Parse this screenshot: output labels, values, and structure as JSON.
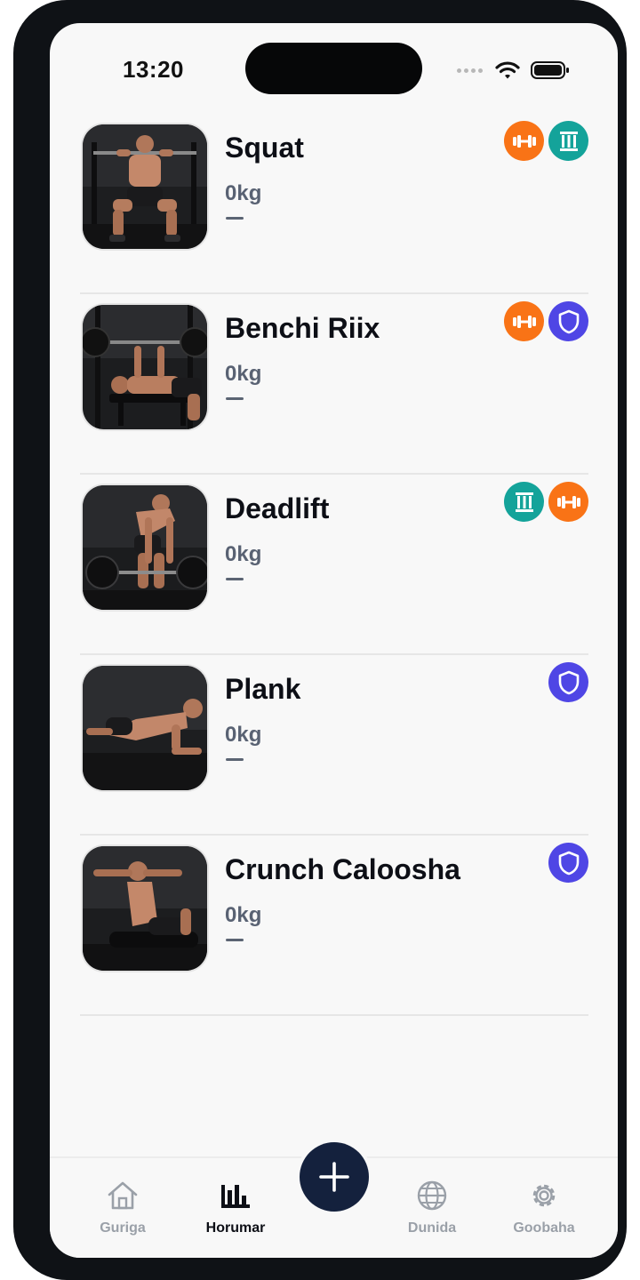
{
  "status_bar": {
    "time": "13:20"
  },
  "exercises": [
    {
      "name": "Squat",
      "weight": "0kg",
      "last": "—",
      "badges": [
        "dumbbell-icon",
        "pillar-icon"
      ]
    },
    {
      "name": "Benchi Riix",
      "weight": "0kg",
      "last": "—",
      "badges": [
        "dumbbell-icon",
        "shield-icon"
      ]
    },
    {
      "name": "Deadlift",
      "weight": "0kg",
      "last": "—",
      "badges": [
        "pillar-icon",
        "dumbbell-icon"
      ]
    },
    {
      "name": "Plank",
      "weight": "0kg",
      "last": "—",
      "badges": [
        "shield-icon"
      ]
    },
    {
      "name": "Crunch Caloosha",
      "weight": "0kg",
      "last": "—",
      "badges": [
        "shield-icon"
      ]
    }
  ],
  "badge_colors": {
    "dumbbell": "#f97316",
    "pillar": "#14a39a",
    "shield": "#4f46e5"
  },
  "nav": {
    "items": [
      {
        "label": "Guriga",
        "icon": "home-icon",
        "active": false
      },
      {
        "label": "Horumar",
        "icon": "bar-chart-icon",
        "active": true
      },
      {
        "label": "Dunida",
        "icon": "globe-icon",
        "active": false
      },
      {
        "label": "Goobaha",
        "icon": "gear-icon",
        "active": false
      }
    ],
    "fab_icon": "plus-icon"
  },
  "colors": {
    "nav_active": "#0d0f16",
    "nav_inactive": "#9aa0a8",
    "fab": "#14213d"
  }
}
